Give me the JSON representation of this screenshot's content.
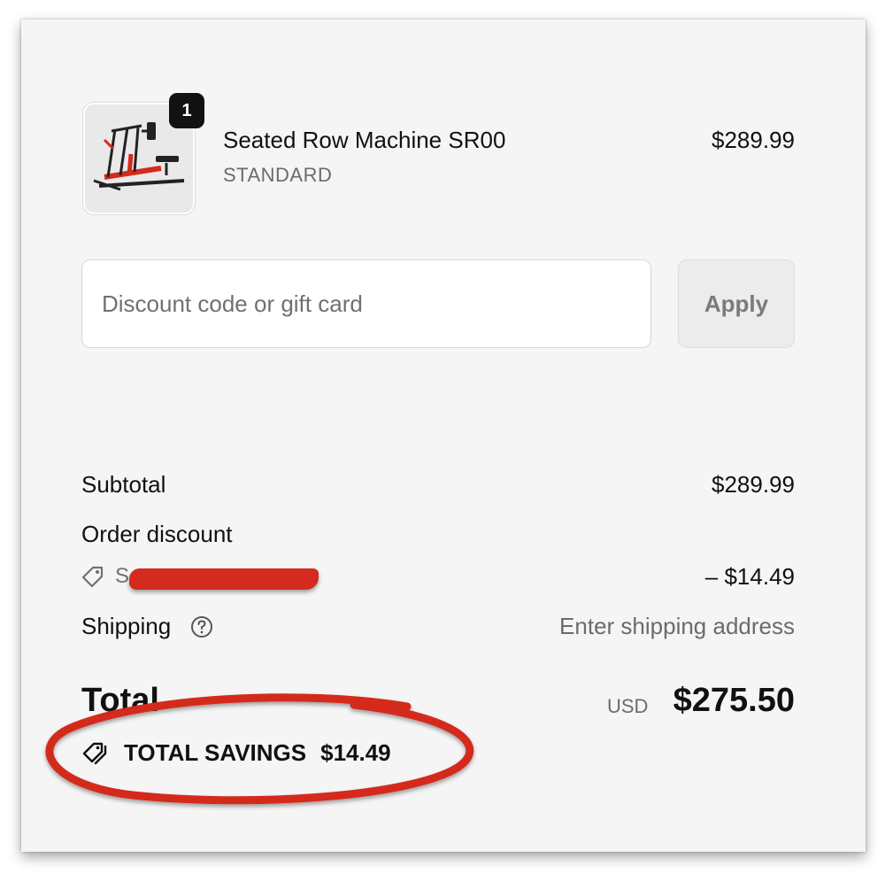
{
  "cart": {
    "item": {
      "quantity": "1",
      "name": "Seated Row Machine SR00",
      "variant": "STANDARD",
      "price": "$289.99",
      "image_icon": "rowing-machine-image"
    }
  },
  "discount": {
    "placeholder": "Discount code or gift card",
    "value": "",
    "apply_label": "Apply"
  },
  "summary": {
    "subtotal_label": "Subtotal",
    "subtotal_value": "$289.99",
    "order_discount_label": "Order discount",
    "discount_code_visible": "S",
    "discount_value": "– $14.49",
    "shipping_label": "Shipping",
    "shipping_value": "Enter shipping address",
    "total_label": "Total",
    "currency": "USD",
    "total_value": "$275.50",
    "savings_label": "TOTAL SAVINGS",
    "savings_value": "$14.49"
  },
  "colors": {
    "background": "#f5f5f5",
    "badge": "#111111",
    "annotation_red": "#d42a1f"
  }
}
